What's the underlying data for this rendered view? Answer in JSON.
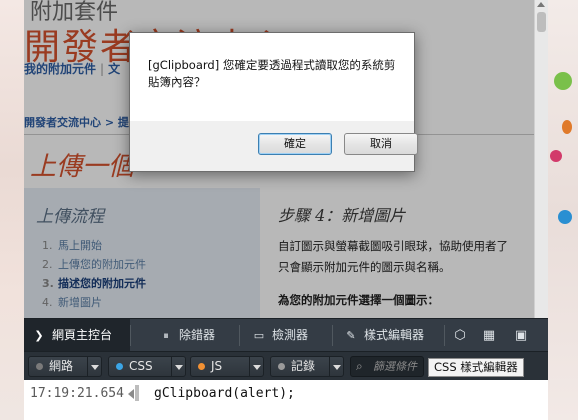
{
  "page": {
    "addons_title": "附加套件",
    "big_title": "開發者交流中心",
    "nav": [
      "我的附加元件",
      "文"
    ],
    "breadcrumb": "開發者交流中心 > 提",
    "upload_title": "上傳一個",
    "process": {
      "title": "上傳流程",
      "steps": [
        {
          "num": "1.",
          "label": "馬上開始"
        },
        {
          "num": "2.",
          "label": "上傳您的附加元件"
        },
        {
          "num": "3.",
          "label": "描述您的附加元件"
        },
        {
          "num": "4.",
          "label": "新增圖片"
        }
      ],
      "current_step": 3
    },
    "step": {
      "title": "步驟 4：新增圖片",
      "desc_line1": "自訂圖示與螢幕截圖吸引眼球，協助使用者了",
      "desc_line2": "只會顯示附加元件的圖示與名稱。",
      "hint": "為您的附加元件選擇一個圖示："
    }
  },
  "dialog": {
    "message": "[gClipboard] 您確定要透過程式讀取您的系統剪貼簿內容？",
    "ok_label": "確定",
    "cancel_label": "取消"
  },
  "devtools": {
    "tabs": [
      {
        "label": "網頁主控台",
        "icon": "console-icon",
        "glyph": "❯"
      },
      {
        "label": "除錯器",
        "icon": "debugger-icon",
        "glyph": "⏸"
      },
      {
        "label": "檢測器",
        "icon": "inspector-icon",
        "glyph": "▭"
      },
      {
        "label": "樣式編輯器",
        "icon": "style-editor-icon",
        "glyph": "✎"
      }
    ],
    "active_tab": 0,
    "filters": [
      {
        "label": "網路",
        "color": "#7a7a7a"
      },
      {
        "label": "CSS",
        "color": "#3ba5e6"
      },
      {
        "label": "JS",
        "color": "#f29133"
      },
      {
        "label": "記錄",
        "color": "#9a9a9a"
      }
    ],
    "filter_placeholder": "篩選條件",
    "tooltip": "CSS 樣式編輯器",
    "console": {
      "timestamp": "17:19:21.654",
      "input": "gClipboard(alert);"
    }
  }
}
